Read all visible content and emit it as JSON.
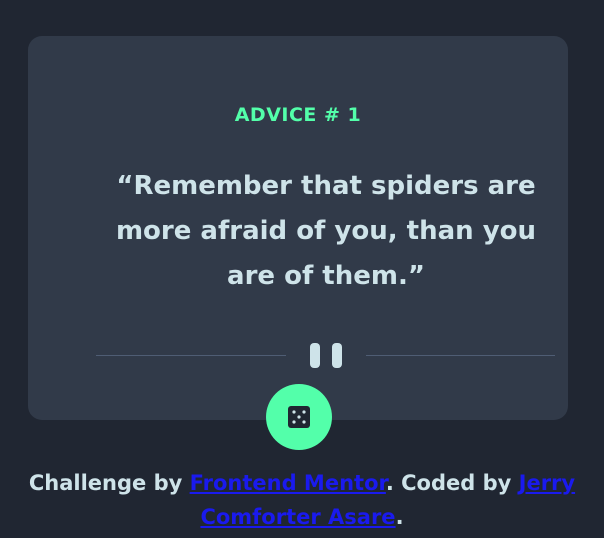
{
  "card": {
    "title": "ADVICE # 1",
    "quote": "“Remember that spiders are more afraid of you, than you are of them.”"
  },
  "dice_button": {
    "icon": "dice-icon"
  },
  "divider": {
    "icon": "pause-icon"
  },
  "footer": {
    "prefix": "Challenge by ",
    "link1": "Frontend Mentor",
    "middle": ". Coded by ",
    "link2": "Jerry Comforter Asare",
    "suffix": "."
  },
  "colors": {
    "background": "#202632",
    "card": "#313a49",
    "accent": "#53ffaa",
    "text": "#cee3e9",
    "divider": "#4f5d74",
    "link": "#1a1aee"
  }
}
